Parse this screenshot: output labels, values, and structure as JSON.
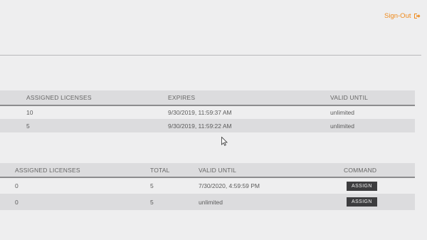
{
  "header": {
    "signout_label": "Sign-Out",
    "signout_icon": "sign-out-icon",
    "accent_color": "#ef8a1c"
  },
  "licenses_table_1": {
    "columns": [
      "ASSIGNED LICENSES",
      "EXPIRES",
      "VALID UNTIL"
    ],
    "rows": [
      [
        "10",
        "9/30/2019, 11:59:37 AM",
        "unlimited"
      ],
      [
        "5",
        "9/30/2019, 11:59:22 AM",
        "unlimited"
      ]
    ]
  },
  "licenses_table_2": {
    "columns": [
      "ASSIGNED LICENSES",
      "TOTAL",
      "VALID UNTIL",
      "COMMAND"
    ],
    "rows": [
      [
        "0",
        "5",
        "7/30/2020, 4:59:59 PM",
        "ASSIGN"
      ],
      [
        "0",
        "5",
        "unlimited",
        "ASSIGN"
      ]
    ]
  }
}
